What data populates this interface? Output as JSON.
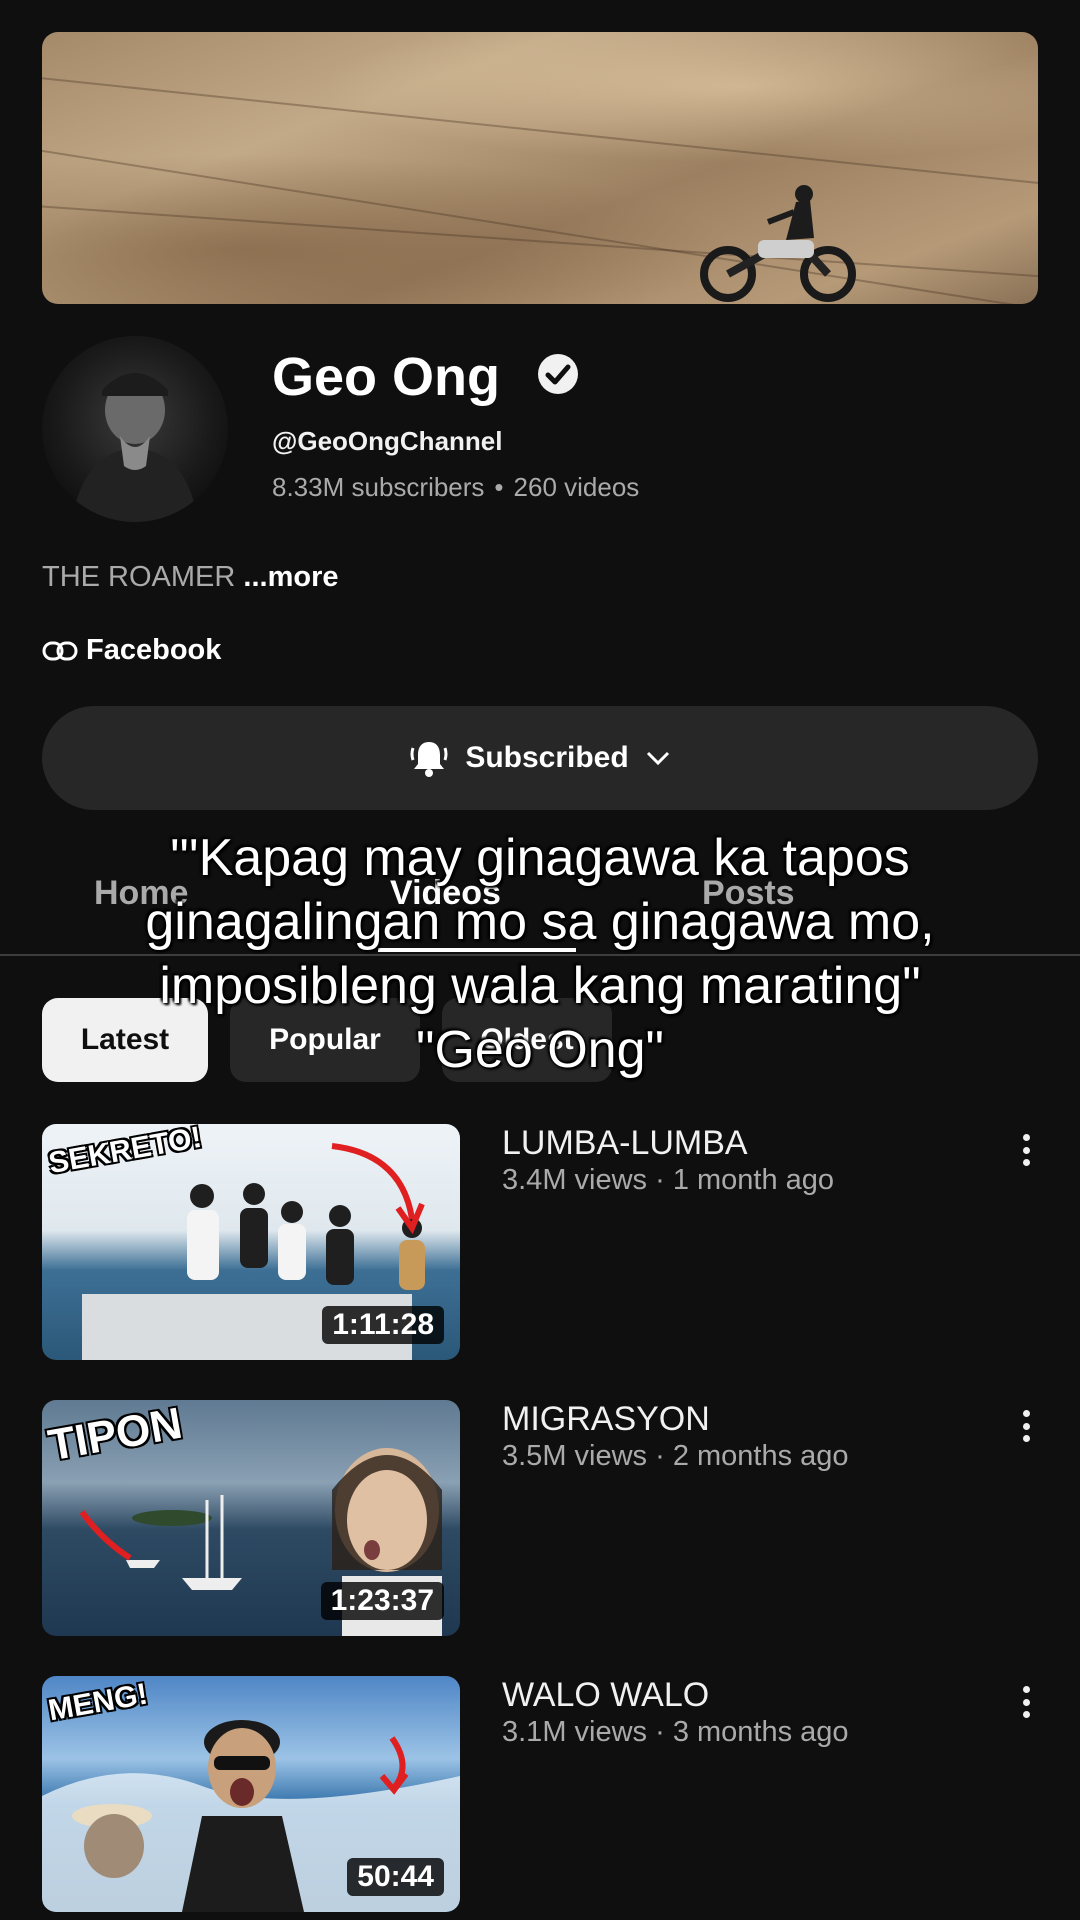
{
  "channel": {
    "name": "Geo Ong",
    "handle": "@GeoOngChannel",
    "subscribers": "8.33M subscribers",
    "separator": "•",
    "video_count": "260 videos",
    "description": "THE ROAMER",
    "more_label": "...more",
    "link_label": "Facebook"
  },
  "subscribe": {
    "label": "Subscribed"
  },
  "tabs": [
    {
      "label": "Home"
    },
    {
      "label": "Videos"
    },
    {
      "label": "Posts"
    }
  ],
  "filters": [
    {
      "label": "Latest"
    },
    {
      "label": "Popular"
    },
    {
      "label": "Oldest"
    }
  ],
  "caption": {
    "lines": [
      "\"'Kapag may ginagawa ka tapos",
      "ginagalingan mo sa ginagawa mo,",
      "imposibleng wala kang marating\"",
      "\"Geo Ong\""
    ]
  },
  "videos": [
    {
      "title": "LUMBA-LUMBA",
      "meta": "3.4M views · 1 month ago",
      "duration": "1:11:28",
      "thumb_text": "SEKRETO!"
    },
    {
      "title": "MIGRASYON",
      "meta": "3.5M views · 2 months ago",
      "duration": "1:23:37",
      "thumb_text": "TIPON"
    },
    {
      "title": "WALO WALO",
      "meta": "3.1M views · 3 months ago",
      "duration": "50:44",
      "thumb_text": "MENG!"
    }
  ],
  "colors": {
    "background": "#0f0f0f",
    "surface": "#272727",
    "secondary_text": "#aaaaaa",
    "accent_arrow": "#e02020"
  }
}
